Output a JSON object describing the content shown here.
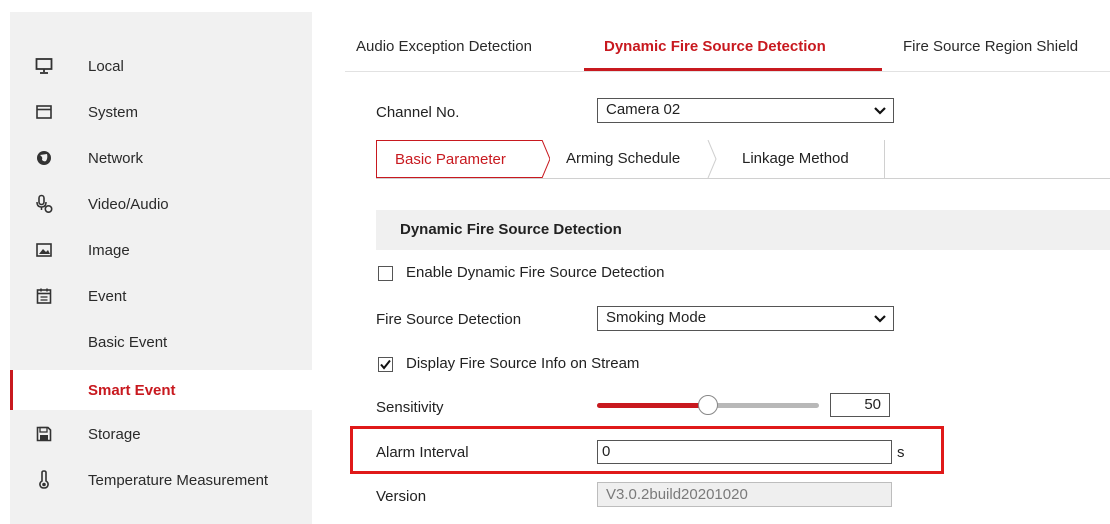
{
  "sidebar": {
    "items": [
      {
        "label": "Local",
        "icon": "monitor-icon"
      },
      {
        "label": "System",
        "icon": "system-window-icon"
      },
      {
        "label": "Network",
        "icon": "network-globe-icon"
      },
      {
        "label": "Video/Audio",
        "icon": "video-audio-icon"
      },
      {
        "label": "Image",
        "icon": "image-icon"
      },
      {
        "label": "Event",
        "icon": "calendar-event-icon"
      },
      {
        "label": "Basic Event"
      },
      {
        "label": "Smart Event",
        "active": true
      },
      {
        "label": "Storage",
        "icon": "floppy-disk-icon"
      },
      {
        "label": "Temperature Measurement",
        "icon": "thermometer-icon"
      }
    ]
  },
  "tabs": [
    {
      "label": "Audio Exception Detection"
    },
    {
      "label": "Dynamic Fire Source Detection",
      "active": true
    },
    {
      "label": "Fire Source Region Shield"
    }
  ],
  "form": {
    "channel_label": "Channel No.",
    "channel_value": "Camera 02",
    "subtabs": [
      {
        "label": "Basic Parameter",
        "active": true
      },
      {
        "label": "Arming Schedule"
      },
      {
        "label": "Linkage Method"
      }
    ],
    "section_title": "Dynamic Fire Source Detection",
    "enable_label": "Enable Dynamic Fire Source Detection",
    "enable_checked": false,
    "fire_detection_label": "Fire Source Detection",
    "fire_detection_value": "Smoking Mode",
    "display_info_label": "Display Fire Source Info on Stream",
    "display_info_checked": true,
    "sensitivity_label": "Sensitivity",
    "sensitivity_value": "50",
    "sensitivity_fraction": 0.5,
    "alarm_interval_label": "Alarm Interval",
    "alarm_interval_value": "0",
    "alarm_interval_unit": "s",
    "version_label": "Version",
    "version_value": "V3.0.2build20201020"
  },
  "colors": {
    "accent": "#c8191f",
    "highlight": "#e01919"
  }
}
